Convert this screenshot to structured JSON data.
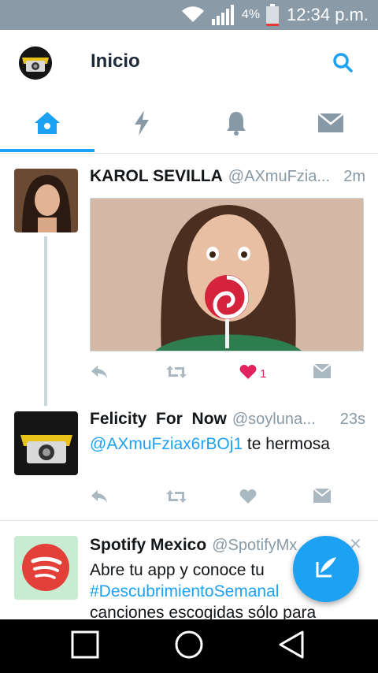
{
  "status": {
    "battery_percent": "4%",
    "time": "12:34 p.m."
  },
  "header": {
    "title": "Inicio"
  },
  "tabs": [
    {
      "name": "home",
      "active": true
    },
    {
      "name": "moments",
      "active": false
    },
    {
      "name": "notifications",
      "active": false
    },
    {
      "name": "messages",
      "active": false
    }
  ],
  "tweets": [
    {
      "name": "KAROL SEVILLA",
      "handle": "@AXmuFzia...",
      "time": "2m",
      "likes": "1",
      "liked": true
    },
    {
      "name": "Felicity  For  Now",
      "handle": "@soyluna...",
      "time": "23s",
      "mention": "@AXmuFziax6rBOj1",
      "text": " te hermosa"
    },
    {
      "name": "Spotify Mexico",
      "handle": "@SpotifyMx",
      "line1": "Abre tu app y conoce tu",
      "hashtag": "#DescubrimientoSemanal",
      "line3": "canciones escogidas sólo para"
    }
  ],
  "colors": {
    "accent": "#1da1f2",
    "like": "#e0245e",
    "statusbar": "#8a9aa7"
  }
}
